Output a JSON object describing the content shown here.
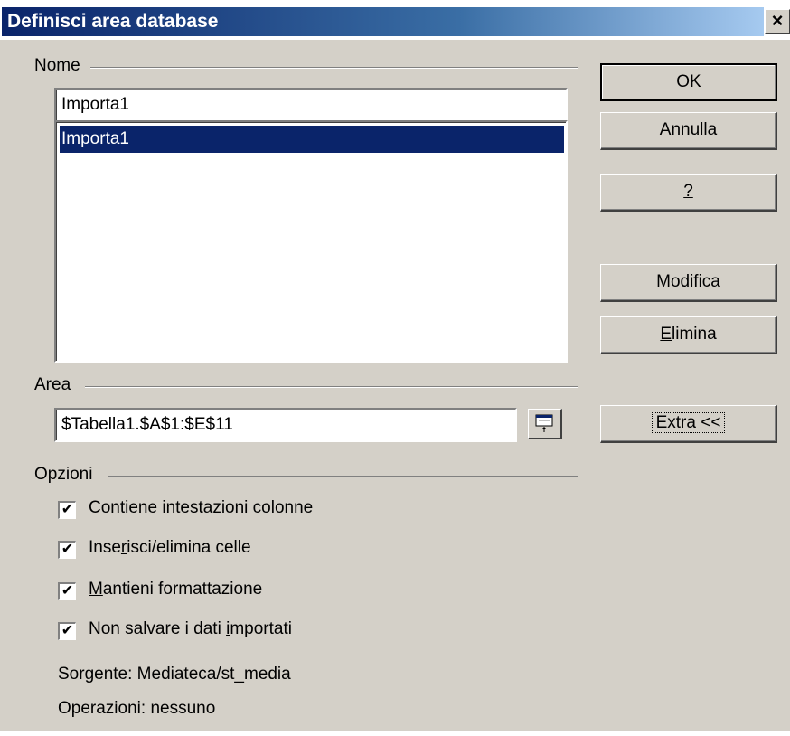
{
  "window": {
    "title": "Definisci area database",
    "close_glyph": "×"
  },
  "nome": {
    "label": "Nome",
    "input_value": "Importa1",
    "list_items": [
      "Importa1"
    ]
  },
  "area": {
    "label": "Area",
    "input_value": "$Tabella1.$A$1:$E$11",
    "shrink_icon": "shrink-dialog-icon"
  },
  "opzioni": {
    "label": "Opzioni",
    "checkboxes": [
      {
        "pre": "",
        "u": "C",
        "post": "ontiene intestazioni colonne",
        "checked": true
      },
      {
        "pre": "Inse",
        "u": "r",
        "post": "isci/elimina celle",
        "checked": true
      },
      {
        "pre": "",
        "u": "M",
        "post": "antieni formattazione",
        "checked": true
      },
      {
        "pre": "Non salvare i dati ",
        "u": "i",
        "post": "mportati",
        "checked": true
      }
    ],
    "source_text": "Sorgente: Mediateca/st_media",
    "operations_text": "Operazioni: nessuno"
  },
  "buttons": {
    "ok": "OK",
    "cancel": "Annulla",
    "help_u": "?",
    "modify_u": "M",
    "modify_post": "odifica",
    "delete_u": "E",
    "delete_post": "limina",
    "extra_pre": "E",
    "extra_u": "x",
    "extra_post": "tra <<"
  },
  "colors": {
    "title_bar": "#0a246a",
    "selection": "#0a246a",
    "dialog_bg": "#d4d0c8"
  }
}
